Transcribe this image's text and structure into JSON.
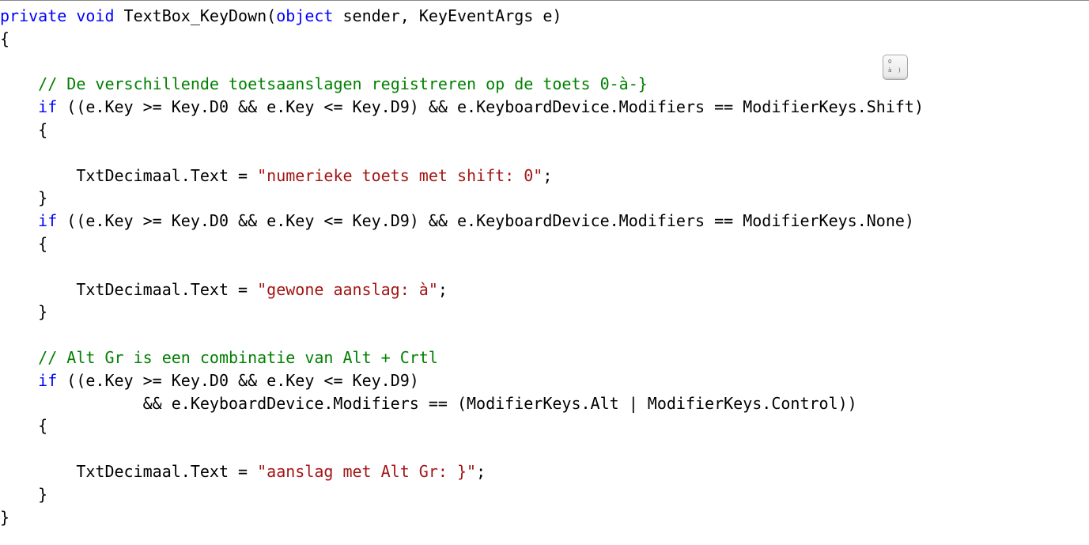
{
  "colors": {
    "keyword": "#0000ff",
    "comment": "#008000",
    "string": "#a31515",
    "plain": "#000000",
    "background": "#ffffff"
  },
  "key_icon": {
    "icon": "keyboard-key-icon",
    "top_char": "0",
    "bottom_left_char": "à",
    "bottom_right_char": ")"
  },
  "lines": [
    [
      {
        "t": "kw",
        "v": "private"
      },
      {
        "t": "pl",
        "v": " "
      },
      {
        "t": "kw",
        "v": "void"
      },
      {
        "t": "pl",
        "v": " TextBox_KeyDown("
      },
      {
        "t": "kw",
        "v": "object"
      },
      {
        "t": "pl",
        "v": " sender, KeyEventArgs e)"
      }
    ],
    [
      {
        "t": "pl",
        "v": "{"
      }
    ],
    [
      {
        "t": "pl",
        "v": ""
      }
    ],
    [
      {
        "t": "pl",
        "v": "    "
      },
      {
        "t": "cm",
        "v": "// De verschillende toetsaanslagen registreren op de toets 0-à-}"
      }
    ],
    [
      {
        "t": "pl",
        "v": "    "
      },
      {
        "t": "kw",
        "v": "if"
      },
      {
        "t": "pl",
        "v": " ((e.Key >= Key.D0 && e.Key <= Key.D9) && e.KeyboardDevice.Modifiers == ModifierKeys.Shift)"
      }
    ],
    [
      {
        "t": "pl",
        "v": "    {"
      }
    ],
    [
      {
        "t": "pl",
        "v": ""
      }
    ],
    [
      {
        "t": "pl",
        "v": "        TxtDecimaal.Text = "
      },
      {
        "t": "st",
        "v": "\"numerieke toets met shift: 0\""
      },
      {
        "t": "pl",
        "v": ";"
      }
    ],
    [
      {
        "t": "pl",
        "v": "    }"
      }
    ],
    [
      {
        "t": "pl",
        "v": "    "
      },
      {
        "t": "kw",
        "v": "if"
      },
      {
        "t": "pl",
        "v": " ((e.Key >= Key.D0 && e.Key <= Key.D9) && e.KeyboardDevice.Modifiers == ModifierKeys.None)"
      }
    ],
    [
      {
        "t": "pl",
        "v": "    {"
      }
    ],
    [
      {
        "t": "pl",
        "v": ""
      }
    ],
    [
      {
        "t": "pl",
        "v": "        TxtDecimaal.Text = "
      },
      {
        "t": "st",
        "v": "\"gewone aanslag: à\""
      },
      {
        "t": "pl",
        "v": ";"
      }
    ],
    [
      {
        "t": "pl",
        "v": "    }"
      }
    ],
    [
      {
        "t": "pl",
        "v": ""
      }
    ],
    [
      {
        "t": "pl",
        "v": "    "
      },
      {
        "t": "cm",
        "v": "// Alt Gr is een combinatie van Alt + Crtl"
      }
    ],
    [
      {
        "t": "pl",
        "v": "    "
      },
      {
        "t": "kw",
        "v": "if"
      },
      {
        "t": "pl",
        "v": " ((e.Key >= Key.D0 && e.Key <= Key.D9)"
      }
    ],
    [
      {
        "t": "pl",
        "v": "               && e.KeyboardDevice.Modifiers == (ModifierKeys.Alt | ModifierKeys.Control))"
      }
    ],
    [
      {
        "t": "pl",
        "v": "    {"
      }
    ],
    [
      {
        "t": "pl",
        "v": ""
      }
    ],
    [
      {
        "t": "pl",
        "v": "        TxtDecimaal.Text = "
      },
      {
        "t": "st",
        "v": "\"aanslag met Alt Gr: }\""
      },
      {
        "t": "pl",
        "v": ";"
      }
    ],
    [
      {
        "t": "pl",
        "v": "    }"
      }
    ],
    [
      {
        "t": "pl",
        "v": "}"
      }
    ]
  ]
}
